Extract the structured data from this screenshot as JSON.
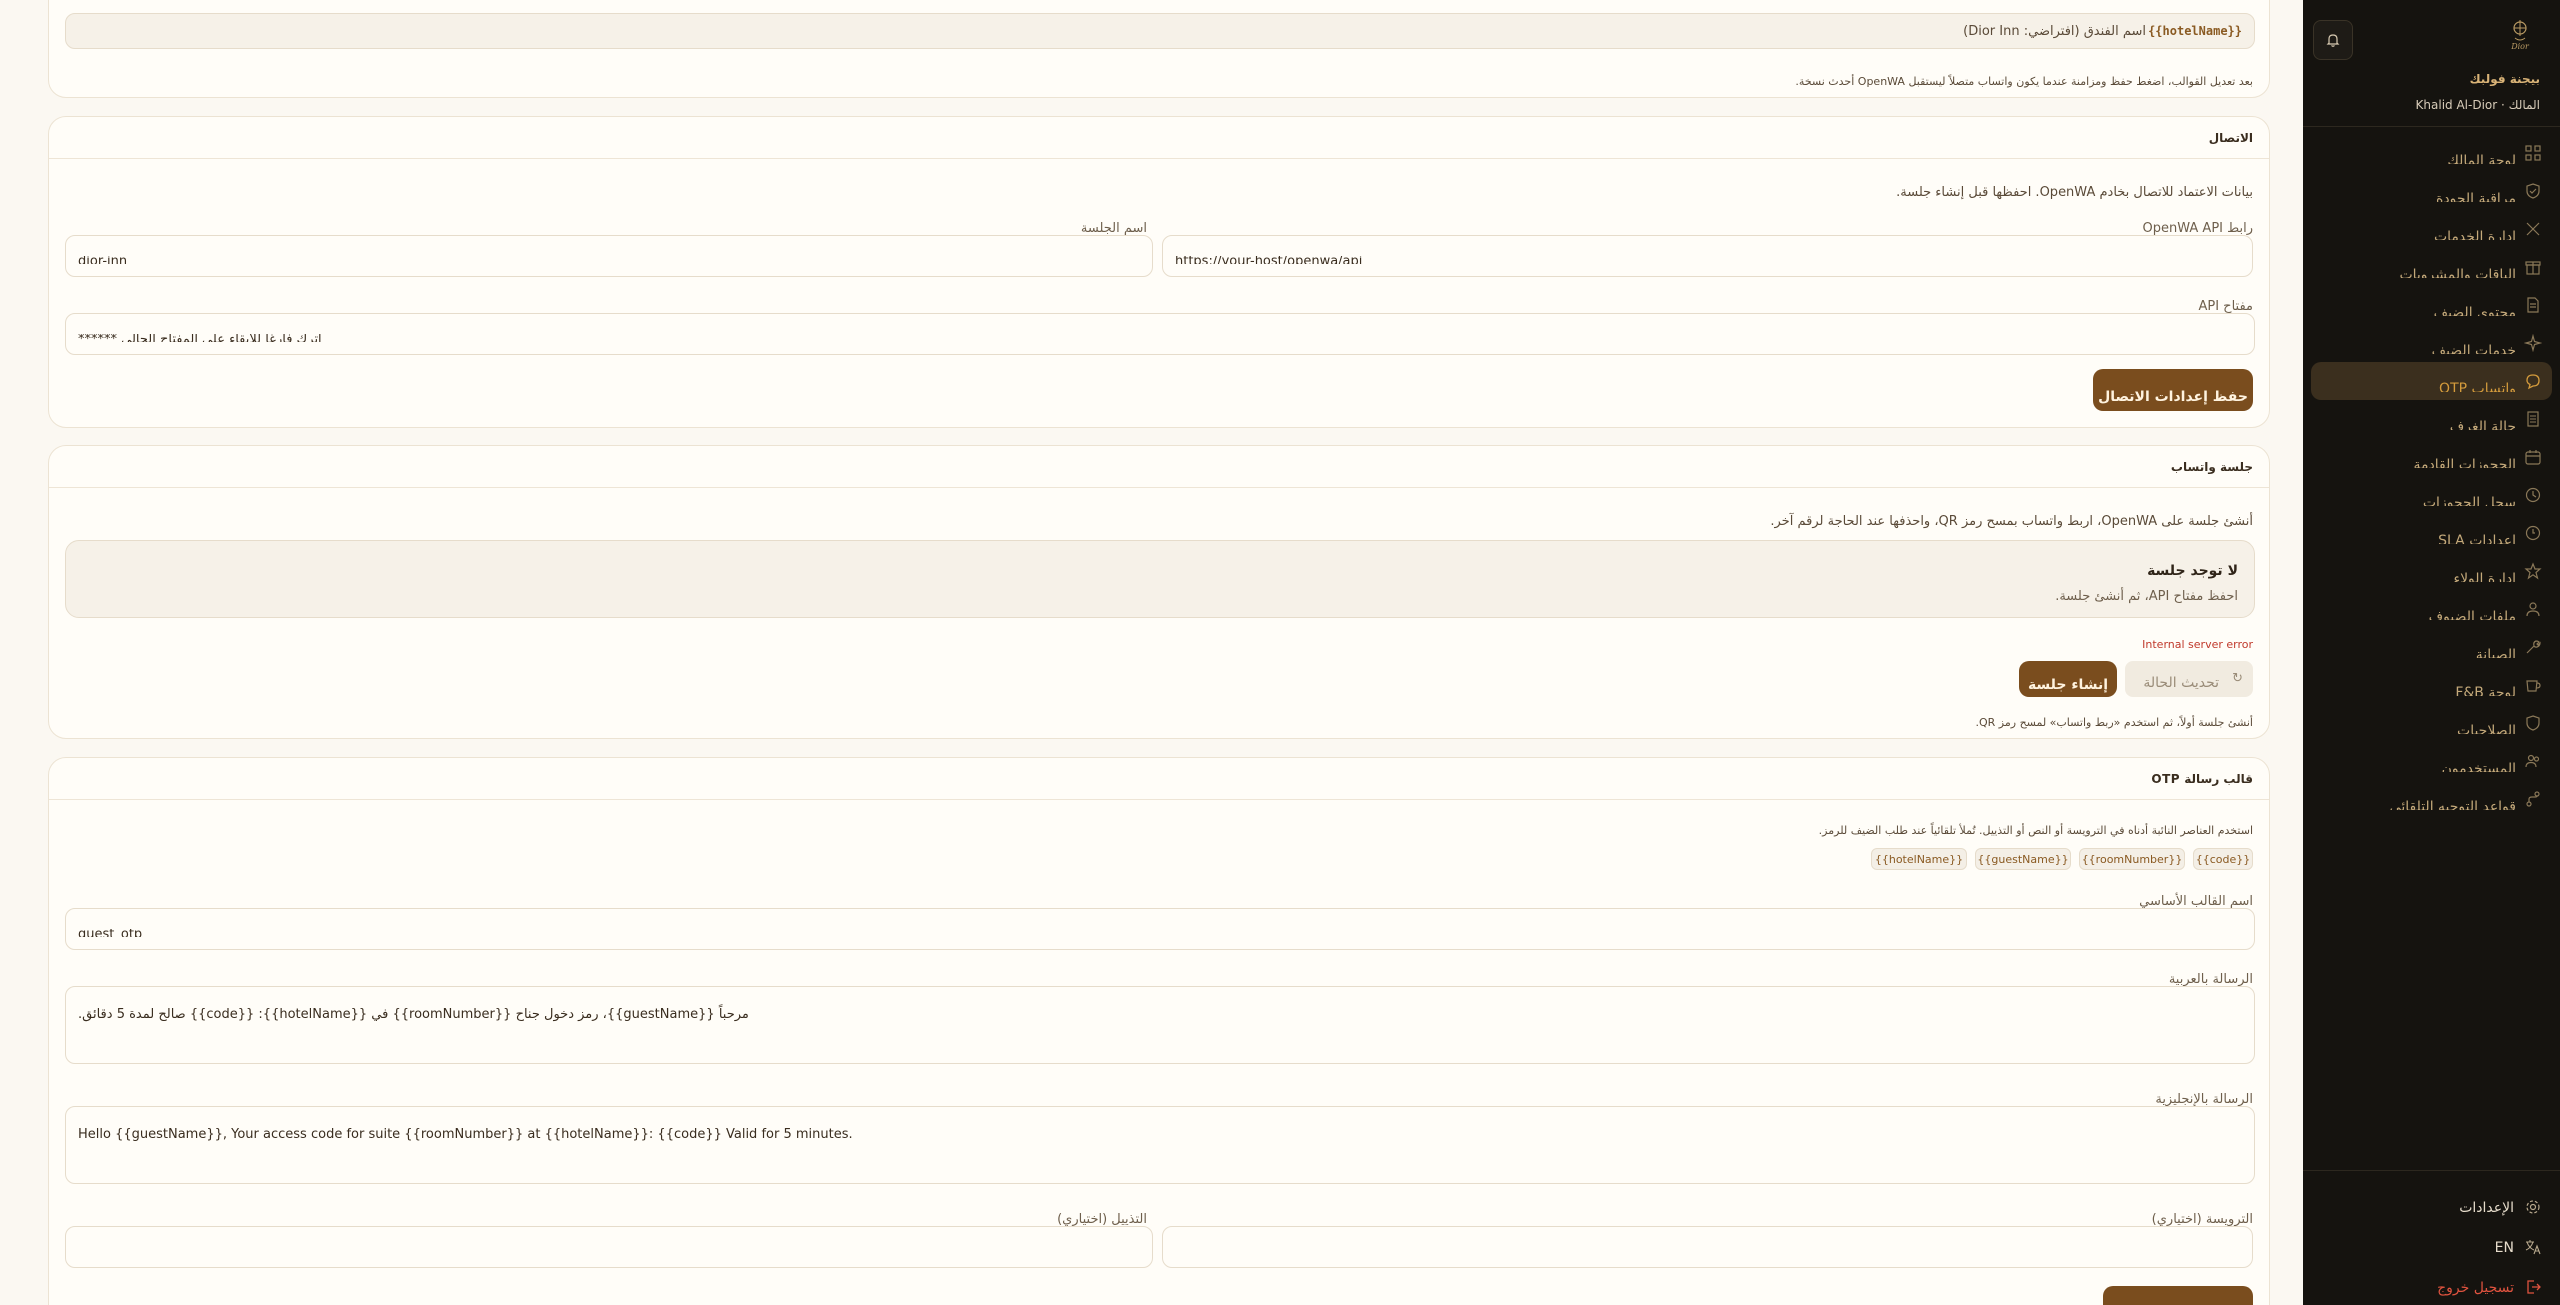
{
  "sidebar": {
    "logo_text": "Dior",
    "brand_name": "بيجنة فولبك",
    "user_line": "المالك · Khalid Al-Dior",
    "nav_items": [
      {
        "label": "لوحة المالك",
        "icon": "grid-icon"
      },
      {
        "label": "مراقبة الجودة",
        "icon": "shield-check-icon"
      },
      {
        "label": "إدارة الخدمات",
        "icon": "tools-icon"
      },
      {
        "label": "الباقات والمشروبات",
        "icon": "gift-icon"
      },
      {
        "label": "محتوى الضيف",
        "icon": "document-icon"
      },
      {
        "label": "خدمات الضيف",
        "icon": "sparkle-icon"
      },
      {
        "label": "واتساب OTP",
        "icon": "chat-icon",
        "active": true
      },
      {
        "label": "حالة الغرف",
        "icon": "room-icon"
      },
      {
        "label": "الحجوزات القادمة",
        "icon": "calendar-icon"
      },
      {
        "label": "سجل الحجوزات",
        "icon": "history-icon"
      },
      {
        "label": "إعدادات SLA",
        "icon": "clock-icon"
      },
      {
        "label": "إدارة الولاء",
        "icon": "star-icon"
      },
      {
        "label": "ملفات الضيوف",
        "icon": "users-icon"
      },
      {
        "label": "الصيانة",
        "icon": "wrench-icon"
      },
      {
        "label": "لوحة F&B",
        "icon": "cup-icon"
      },
      {
        "label": "الصلاحيات",
        "icon": "shield-icon"
      },
      {
        "label": "المستخدمون",
        "icon": "user-group-icon"
      },
      {
        "label": "قواعد التوجيه التلقائي",
        "icon": "route-icon"
      }
    ],
    "bottom": {
      "settings": "الإعدادات",
      "language": "EN",
      "logout": "تسجيل خروج"
    }
  },
  "template_card": {
    "hotel_token": "{{hotelName}}",
    "hotel_token_desc": "اسم الفندق (افتراضي: Dior Inn)",
    "footer_note": "بعد تعديل القوالب، اضغط حفظ ومزامنة عندما يكون واتساب متصلاً ليستقبل OpenWA أحدث نسخة."
  },
  "connection_card": {
    "title": "الاتصال",
    "intro": "بيانات الاعتماد للاتصال بخادم OpenWA. احفظها قبل إنشاء جلسة.",
    "api_url_label": "رابط OpenWA API",
    "api_url_value": "https://your-host/openwa/api",
    "session_name_label": "اسم الجلسة",
    "session_name_value": "dior-inn",
    "api_key_label": "مفتاح API",
    "api_key_value": "اترك فارغاً للإبقاء على المفتاح الحالي ******",
    "save_button": "حفظ إعدادات الاتصال"
  },
  "session_card": {
    "title": "جلسة واتساب",
    "intro": "أنشئ جلسة على OpenWA، اربط واتساب بمسح رمز QR، واحذفها عند الحاجة لرقم آخر.",
    "status_title": "لا توجد جلسة",
    "status_desc": "احفظ مفتاح API، ثم أنشئ جلسة.",
    "error_text": "Internal server error",
    "refresh_button": "تحديث الحالة",
    "create_button": "إنشاء جلسة",
    "footer_note": "أنشئ جلسة أولاً، ثم استخدم «ربط واتساب» لمسح رمز QR."
  },
  "otp_card": {
    "title": "قالب رسالة OTP",
    "intro": "استخدم العناصر النائبة أدناه في الترويسة أو النص أو التذييل. تُملأ تلقائياً عند طلب الضيف للرمز.",
    "chips": [
      "{{code}}",
      "{{roomNumber}}",
      "{{guestName}}",
      "{{hotelName}}"
    ],
    "template_name_label": "اسم القالب الأساسي",
    "template_name_value": "guest_otp",
    "arabic_label": "الرسالة بالعربية",
    "arabic_value": "مرحباً {{guestName}}، رمز دخول جناح {{roomNumber}} في {{hotelName}}: {{code}} صالح لمدة 5 دقائق.",
    "english_label": "الرسالة بالإنجليزية",
    "english_value": "Hello {{guestName}}, Your access code for suite {{roomNumber}} at {{hotelName}}: {{code}} Valid for 5 minutes.",
    "header_label": "الترويسة (اختياري)",
    "footer_label": "التذييل (اختياري)"
  },
  "colors": {
    "accent": "#7a4d1e",
    "sidebar_bg": "#15130f",
    "active_nav": "#3b2f1e",
    "error": "#c0392b"
  }
}
